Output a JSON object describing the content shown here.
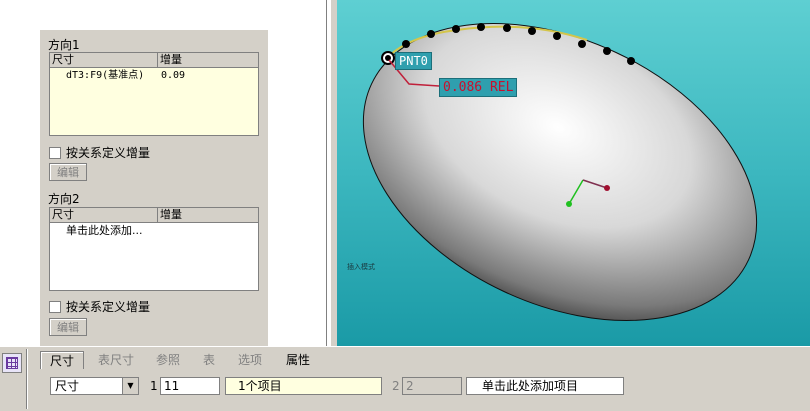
{
  "panel": {
    "dir1_label": "方向1",
    "dir2_label": "方向2",
    "col_dim": "尺寸",
    "col_inc": "增量",
    "dir1_rows": [
      {
        "dim": "dT3:F9(基准点)",
        "inc": "0.09"
      }
    ],
    "dir2_add_text": "单击此处添加...",
    "rel_checkbox_label": "按关系定义增量",
    "edit_button": "编辑"
  },
  "viewport": {
    "pnt_label": "PNT0",
    "dim_label": "0.086 REL",
    "mode_text": "插入模式",
    "colors": {
      "label_bg": "#2f9fae",
      "dim_line": "#c0203a",
      "curve": "#d4c54a"
    }
  },
  "dashboard": {
    "tabs": [
      {
        "label": "尺寸",
        "state": "active"
      },
      {
        "label": "表尺寸",
        "state": "disabled"
      },
      {
        "label": "参照",
        "state": "disabled"
      },
      {
        "label": "表",
        "state": "disabled"
      },
      {
        "label": "选项",
        "state": "disabled"
      },
      {
        "label": "属性",
        "state": "enabled"
      }
    ],
    "type_select": "尺寸",
    "dir1_num": "1",
    "dir1_count": "11",
    "dir1_items": "1个项目",
    "dir2_num": "2",
    "dir2_count": "2",
    "dir2_items": "单击此处添加项目"
  }
}
